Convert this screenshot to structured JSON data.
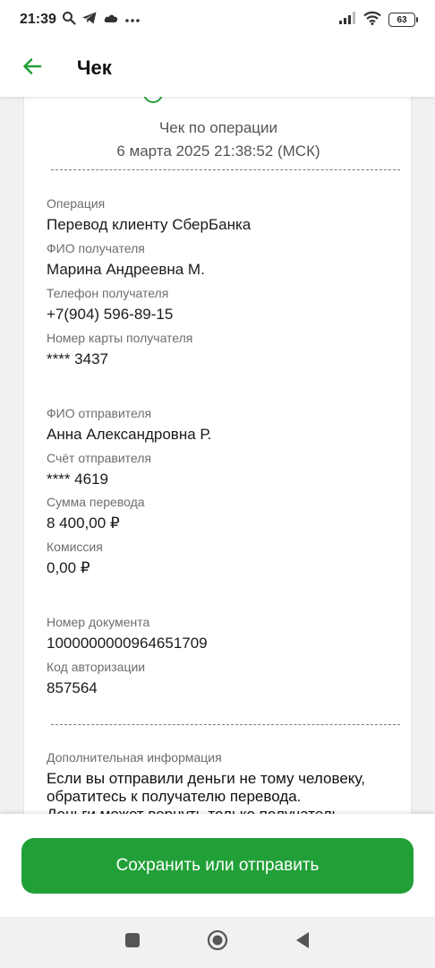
{
  "status_bar": {
    "time": "21:39",
    "battery": "63",
    "left_icons": [
      "search-icon",
      "telegram-icon",
      "cloud-icon",
      "more-dots-icon"
    ],
    "right_icons": [
      "signal-icon",
      "wifi-icon",
      "battery-icon"
    ]
  },
  "app_bar": {
    "title": "Чек",
    "back_icon": "arrow-left-icon",
    "accent_color": "#21a038"
  },
  "receipt": {
    "heading": "Чек по операции",
    "date": "6 марта 2025 21:38:52 (МСК)",
    "fields": [
      {
        "label": "Операция",
        "value": "Перевод клиенту СберБанка"
      },
      {
        "label": "ФИО получателя",
        "value": "Марина Андреевна М."
      },
      {
        "label": "Телефон получателя",
        "value": "+7(904) 596-89-15"
      },
      {
        "label": "Номер карты получателя",
        "value": "**** 3437"
      },
      {
        "label": "ФИО отправителя",
        "value": "Анна Александровна Р."
      },
      {
        "label": "Счёт отправителя",
        "value": "**** 4619"
      },
      {
        "label": "Сумма перевода",
        "value": "8 400,00 ₽"
      },
      {
        "label": "Комиссия",
        "value": "0,00 ₽"
      },
      {
        "label": "Номер документа",
        "value": "1000000000964651709"
      },
      {
        "label": "Код авторизации",
        "value": "857564"
      }
    ],
    "additional_info_label": "Дополнительная информация",
    "additional_info_lines": [
      "Если вы отправили деньги не тому человеку,",
      "обратитесь к получателю перевода.",
      "Деньги может вернуть только получатель"
    ]
  },
  "actions": {
    "primary_button": "Сохранить или отправить"
  },
  "nav_bar": {
    "icons": [
      "recents-square-icon",
      "home-circle-icon",
      "back-triangle-icon"
    ]
  }
}
